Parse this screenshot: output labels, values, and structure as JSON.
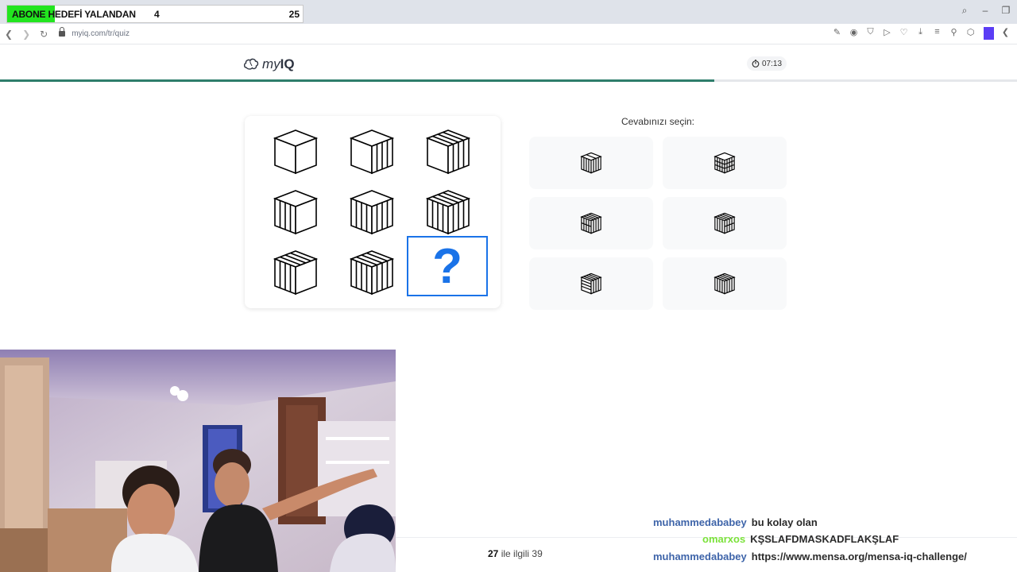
{
  "browser": {
    "url": "myiq.com/tr/quiz",
    "icons": [
      "back-icon",
      "forward-icon",
      "reload-icon",
      "lock-icon",
      "edit-icon",
      "camera-icon",
      "shield-icon",
      "play-icon",
      "heart-icon",
      "download-icon",
      "menu-icon",
      "profile-icon",
      "extension-icon",
      "sidebar-icon"
    ]
  },
  "overlay": {
    "goal_label": "ABONE HEDEFİ YALANDAN",
    "goal_current": "4",
    "goal_max": "25",
    "goal_fill_color": "#22e51f",
    "goal_fill_fraction": 0.16
  },
  "site": {
    "logo_prefix": "my",
    "logo_suffix": "IQ",
    "timer": "07:13",
    "progress_fraction": 0.702,
    "accent": "#1a73e8",
    "progress_color": "#2e7d6b"
  },
  "puzzle": {
    "question_mark": "?",
    "prompt": "Cevabınızı seçin:"
  },
  "footer": {
    "current": "27",
    "text": "ile ilgili",
    "total": "39"
  },
  "chat": [
    {
      "user": "muhammedababey",
      "user_color": "#3e64a9",
      "message": "bu kolay olan"
    },
    {
      "user": "omarxos",
      "user_color": "#7be23a",
      "message": "KŞSLAFDMASKADFLAKŞLAF"
    },
    {
      "user": "muhammedababey",
      "user_color": "#3e64a9",
      "message": "https://www.mensa.org/mensa-iq-challenge/"
    }
  ]
}
